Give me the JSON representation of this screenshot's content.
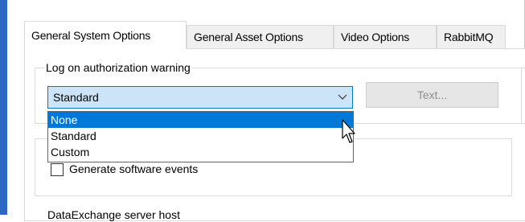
{
  "tabs": [
    {
      "label": "General System Options",
      "active": true
    },
    {
      "label": "General Asset Options",
      "active": false
    },
    {
      "label": "Video Options",
      "active": false
    },
    {
      "label": "RabbitMQ",
      "active": false
    }
  ],
  "auth_group": {
    "legend": "Log on authorization warning",
    "selected_value": "Standard",
    "text_button_label": "Text...",
    "dropdown_options": [
      "None",
      "Standard",
      "Custom"
    ],
    "highlighted_option": "None"
  },
  "events_group": {
    "checkbox_label": "Generate software events",
    "checked": false
  },
  "next_section_label": "DataExchange server host",
  "colors": {
    "accent": "#0078d7",
    "combo_bg": "#cce4f7",
    "window_edge": "#2c67c1"
  },
  "icons": [
    "chevron-down-icon",
    "mouse-cursor-icon"
  ]
}
